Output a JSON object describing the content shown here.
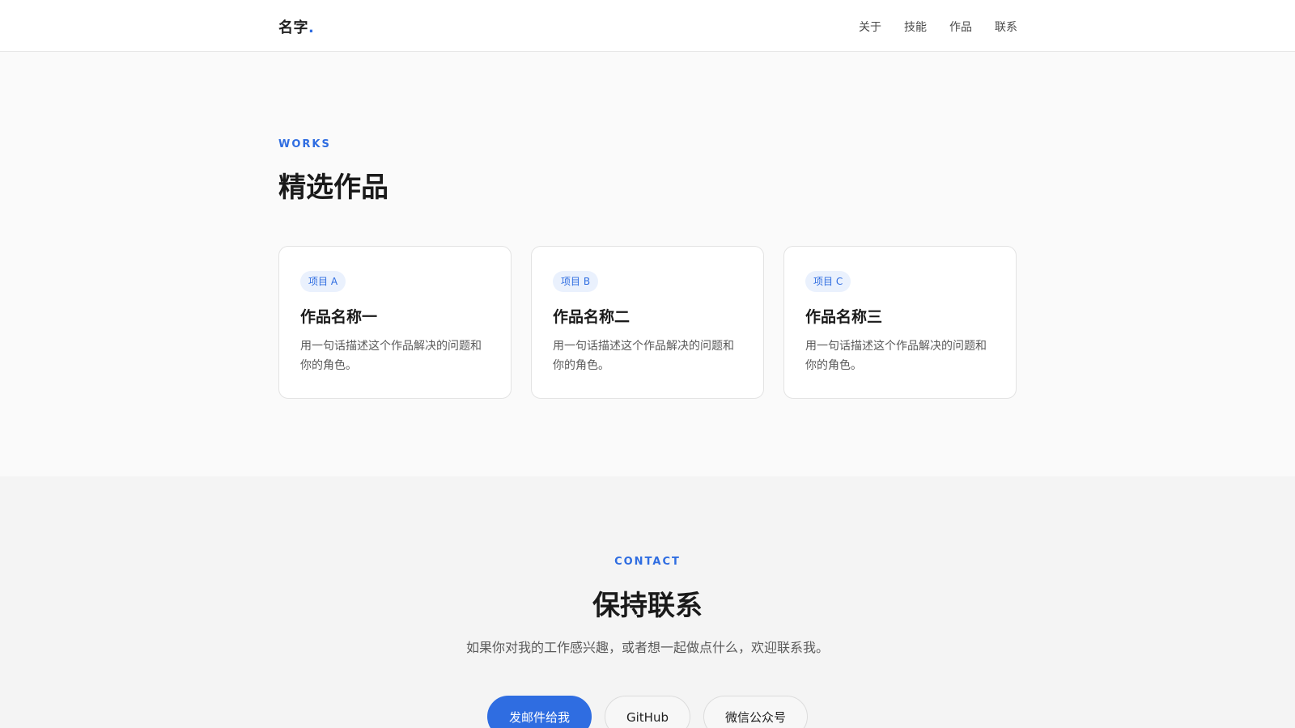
{
  "header": {
    "brand": "名字",
    "brand_dot": ".",
    "nav": [
      {
        "label": "关于"
      },
      {
        "label": "技能"
      },
      {
        "label": "作品"
      },
      {
        "label": "联系"
      }
    ]
  },
  "works": {
    "eyebrow": "WORKS",
    "title": "精选作品",
    "cards": [
      {
        "tag": "项目 A",
        "title": "作品名称一",
        "desc": "用一句话描述这个作品解决的问题和你的角色。"
      },
      {
        "tag": "项目 B",
        "title": "作品名称二",
        "desc": "用一句话描述这个作品解决的问题和你的角色。"
      },
      {
        "tag": "项目 C",
        "title": "作品名称三",
        "desc": "用一句话描述这个作品解决的问题和你的角色。"
      }
    ]
  },
  "contact": {
    "eyebrow": "CONTACT",
    "title": "保持联系",
    "subtitle": "如果你对我的工作感兴趣，或者想一起做点什么，欢迎联系我。",
    "buttons": [
      {
        "label": "发邮件给我"
      },
      {
        "label": "GitHub"
      },
      {
        "label": "微信公众号"
      }
    ]
  },
  "colors": {
    "accent": "#2f6de1",
    "tag_bg": "#eaf1fd",
    "page_bg": "#fafafa",
    "contact_bg": "#f4f4f4"
  }
}
